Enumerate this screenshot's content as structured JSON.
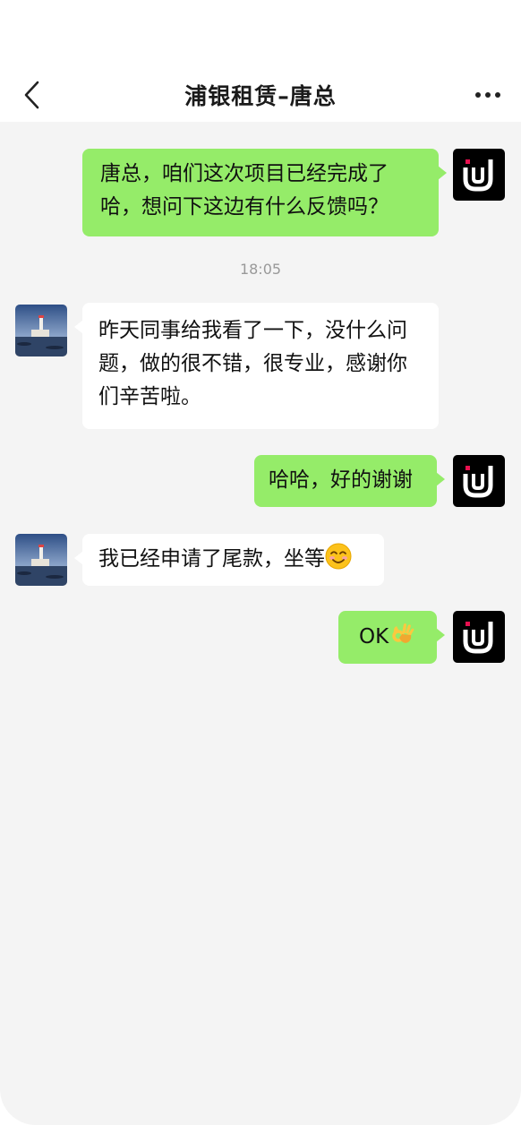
{
  "header": {
    "title": "浦银租赁–唐总",
    "back_icon": "chevron-left-icon",
    "more_icon": "more-dots-icon"
  },
  "messages": [
    {
      "from": "me",
      "text": "唐总，咱们这次项目已经完成了哈，想问下这边有什么反馈吗？"
    },
    {
      "timestamp": "18:05"
    },
    {
      "from": "other",
      "text": "昨天同事给我看了一下，没什么问题，做的很不错，很专业，感谢你们辛苦啦。"
    },
    {
      "from": "me",
      "text": "哈哈，好的谢谢"
    },
    {
      "from": "other",
      "text": "我已经申请了尾款，坐等",
      "emoji": "smiling-face-emoji"
    },
    {
      "from": "me",
      "text": "OK",
      "emoji": "ok-hand-emoji"
    }
  ],
  "colors": {
    "my_bubble": "#95ec69",
    "other_bubble": "#ffffff",
    "chat_bg": "#f4f4f4",
    "brand_logo_bg": "#000000",
    "brand_accent": "#e8104f"
  }
}
